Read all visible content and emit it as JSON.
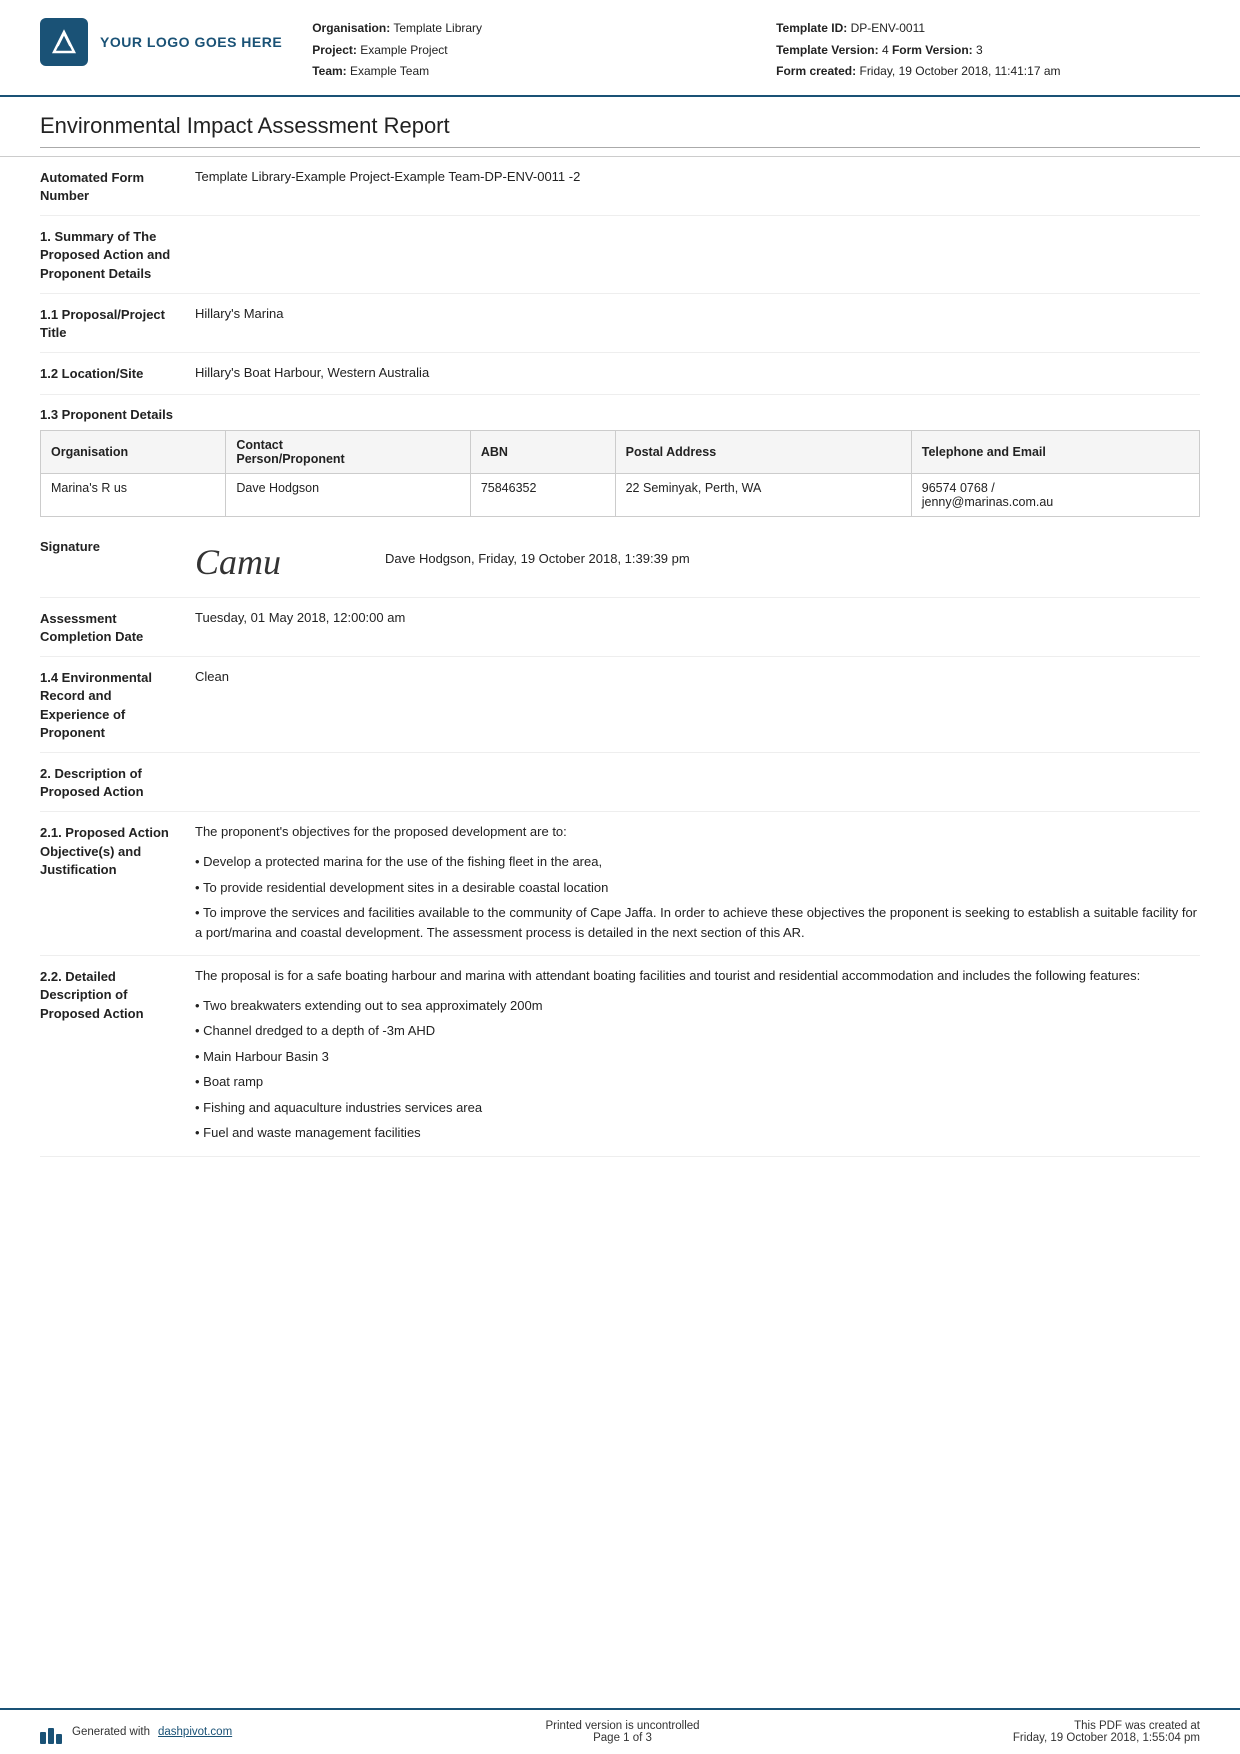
{
  "header": {
    "logo_text": "YOUR LOGO GOES HERE",
    "organisation_label": "Organisation:",
    "organisation_value": "Template Library",
    "project_label": "Project:",
    "project_value": "Example Project",
    "team_label": "Team:",
    "team_value": "Example Team",
    "template_id_label": "Template ID:",
    "template_id_value": "DP-ENV-0011",
    "template_version_label": "Template Version:",
    "template_version_value": "4",
    "form_version_label": "Form Version:",
    "form_version_value": "3",
    "form_created_label": "Form created:",
    "form_created_value": "Friday, 19 October 2018, 11:41:17 am"
  },
  "report": {
    "title": "Environmental Impact Assessment Report",
    "automated_form_number_label": "Automated Form Number",
    "automated_form_number_value": "Template Library-Example Project-Example Team-DP-ENV-0011  -2",
    "section1_label": "1. Summary of The Proposed Action and Proponent Details",
    "section1_1_label": "1.1 Proposal/Project Title",
    "section1_1_value": "Hillary's Marina",
    "section1_2_label": "1.2 Location/Site",
    "section1_2_value": "Hillary's Boat Harbour, Western Australia",
    "section1_3_label": "1.3 Proponent Details",
    "proponent_table": {
      "headers": [
        "Organisation",
        "Contact Person/Proponent",
        "ABN",
        "Postal Address",
        "Telephone and Email"
      ],
      "rows": [
        [
          "Marina's R us",
          "Dave Hodgson",
          "75846352",
          "22 Seminyak, Perth, WA",
          "96574 0768 /\njenny@marinas.com.au"
        ]
      ]
    },
    "signature_label": "Signature",
    "signature_text": "Camu",
    "signature_meta": "Dave Hodgson, Friday, 19 October 2018, 1:39:39 pm",
    "assessment_completion_date_label": "Assessment Completion Date",
    "assessment_completion_date_value": "Tuesday, 01 May 2018, 12:00:00 am",
    "section1_4_label": "1.4 Environmental Record and Experience of Proponent",
    "section1_4_value": "Clean",
    "section2_label": "2. Description of Proposed Action",
    "section2_1_label": "2.1. Proposed Action Objective(s) and Justification",
    "section2_1_intro": "The proponent's objectives for the proposed development are to:",
    "section2_1_bullets": [
      "Develop a protected marina for the use of the fishing fleet in the area,",
      "To provide residential development sites in a desirable coastal location",
      "To improve the services and facilities available to the community of Cape Jaffa. In order to achieve these objectives the proponent is seeking to establish a suitable facility for a port/marina and coastal development. The assessment process is detailed in the next section of this AR."
    ],
    "section2_2_label": "2.2. Detailed Description of Proposed Action",
    "section2_2_intro": "The proposal is for a safe boating harbour and marina with attendant boating facilities and tourist and residential accommodation and includes the following features:",
    "section2_2_bullets": [
      "Two breakwaters extending out to sea approximately 200m",
      "Channel dredged to a depth of -3m AHD",
      "Main Harbour Basin 3",
      "Boat ramp",
      "Fishing and aquaculture industries services area",
      "Fuel and waste management facilities"
    ]
  },
  "footer": {
    "generated_by_prefix": "Generated with ",
    "generated_by_link": "dashpivot.com",
    "page_info": "Printed version is uncontrolled\nPage 1 of 3",
    "pdf_created": "This PDF was created at\nFriday, 19 October 2018, 1:55:04 pm"
  }
}
